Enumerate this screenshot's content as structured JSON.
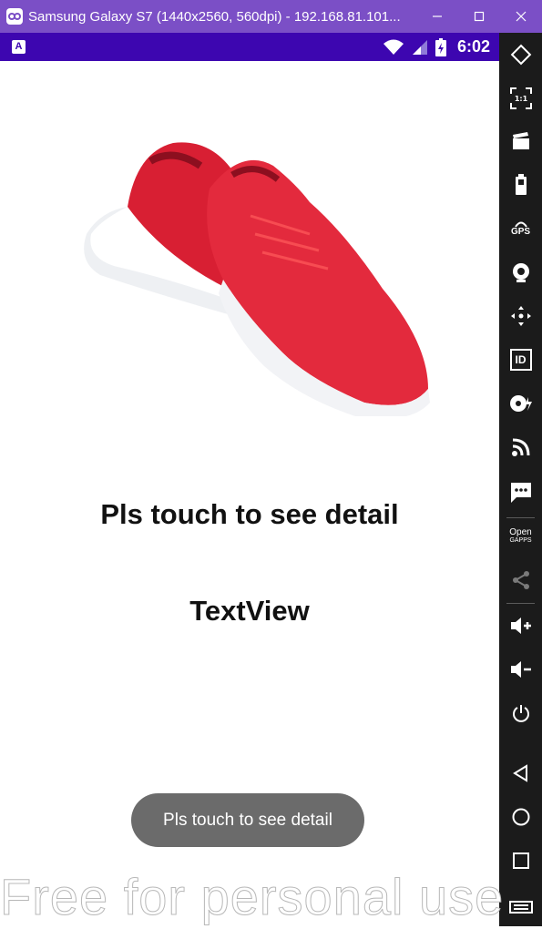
{
  "window": {
    "title": "Samsung Galaxy S7 (1440x2560, 560dpi) - 192.168.81.101...",
    "minimize_label": "minimize",
    "maximize_label": "maximize",
    "close_label": "close"
  },
  "statusbar": {
    "notification_glyph": "A",
    "time": "6:02"
  },
  "app": {
    "headline": "Pls touch to see detail",
    "textview": "TextView",
    "toast": "Pls touch to see detail"
  },
  "sidebar": {
    "items": [
      {
        "icon": "rotate-icon"
      },
      {
        "icon": "pixel-perfect-icon",
        "label": "1:1"
      },
      {
        "icon": "screen-record-icon"
      },
      {
        "icon": "battery-icon"
      },
      {
        "icon": "gps-icon",
        "label": "GPS"
      },
      {
        "icon": "camera-icon"
      },
      {
        "icon": "move-icon"
      },
      {
        "icon": "identifiers-icon",
        "label": "ID"
      },
      {
        "icon": "disk-icon"
      },
      {
        "icon": "wifi-cast-icon"
      },
      {
        "icon": "sms-icon"
      },
      {
        "icon": "open-gapps-icon",
        "label": "Open",
        "sublabel": "GAPPS"
      },
      {
        "icon": "share-icon"
      },
      {
        "icon": "volume-up-icon"
      },
      {
        "icon": "volume-down-icon"
      },
      {
        "icon": "power-icon"
      },
      {
        "icon": "back-icon"
      },
      {
        "icon": "home-icon"
      },
      {
        "icon": "recents-icon"
      },
      {
        "icon": "menu-icon"
      }
    ]
  },
  "watermark": "Free for personal use",
  "colors": {
    "titlebar": "#7b4fc6",
    "statusbar": "#3d06b0",
    "sidebar": "#1b1b1b",
    "toast": "#6b6b6b",
    "shoe": "#e0283a"
  }
}
